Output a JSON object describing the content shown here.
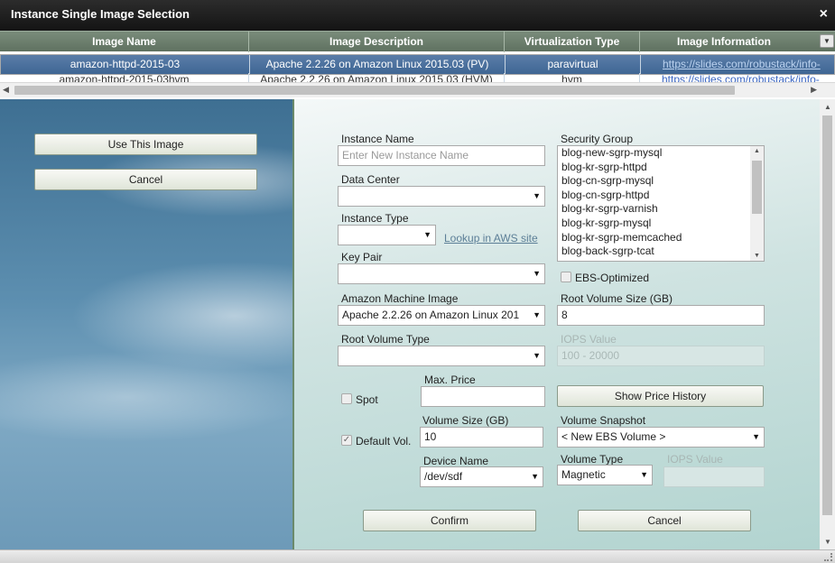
{
  "window": {
    "title": "Instance Single Image Selection",
    "close_icon": "×"
  },
  "grid": {
    "columns": [
      "Image Name",
      "Image Description",
      "Virtualization Type",
      "Image Information"
    ],
    "rows": [
      {
        "name": "amazon-httpd-2015-03",
        "description": "Apache 2.2.26 on Amazon Linux 2015.03 (PV)",
        "virtualization": "paravirtual",
        "info": "https://slides.com/robustack/info-"
      },
      {
        "name": "amazon-httpd-2015-03hvm",
        "description": "Apache 2.2.26 on Amazon Linux 2015.03 (HVM)",
        "virtualization": "hvm",
        "info": "https://slides.com/robustack/info-"
      }
    ]
  },
  "side": {
    "use_image": "Use This Image",
    "cancel": "Cancel"
  },
  "form": {
    "instance_name_label": "Instance Name",
    "instance_name_placeholder": "Enter New Instance Name",
    "data_center_label": "Data Center",
    "data_center_value": "",
    "instance_type_label": "Instance Type",
    "instance_type_value": "",
    "lookup_link": "Lookup in AWS site",
    "key_pair_label": "Key Pair",
    "key_pair_value": "",
    "ami_label": "Amazon Machine Image",
    "ami_value": "Apache 2.2.26 on Amazon Linux 201",
    "root_volume_type_label": "Root Volume Type",
    "root_volume_type_value": "",
    "security_group_label": "Security Group",
    "security_groups": [
      "blog-new-sgrp-mysql",
      "blog-kr-sgrp-httpd",
      "blog-cn-sgrp-mysql",
      "blog-cn-sgrp-httpd",
      "blog-kr-sgrp-varnish",
      "blog-kr-sgrp-mysql",
      "blog-kr-sgrp-memcached",
      "blog-back-sgrp-tcat"
    ],
    "ebs_optimized_label": "EBS-Optimized",
    "root_volume_size_label": "Root Volume Size (GB)",
    "root_volume_size_value": "8",
    "iops_label": "IOPS Value",
    "iops_placeholder": "100 - 20000",
    "spot_label": "Spot",
    "max_price_label": "Max. Price",
    "max_price_value": "",
    "show_price_history": "Show Price History",
    "default_vol_label": "Default Vol.",
    "volume_size_label": "Volume Size (GB)",
    "volume_size_value": "10",
    "volume_snapshot_label": "Volume Snapshot",
    "volume_snapshot_value": "< New EBS Volume >",
    "device_name_label": "Device Name",
    "device_name_value": "/dev/sdf",
    "volume_type_label": "Volume Type",
    "volume_type_value": "Magnetic",
    "iops_value2_label": "IOPS Value",
    "confirm": "Confirm",
    "cancel": "Cancel"
  }
}
